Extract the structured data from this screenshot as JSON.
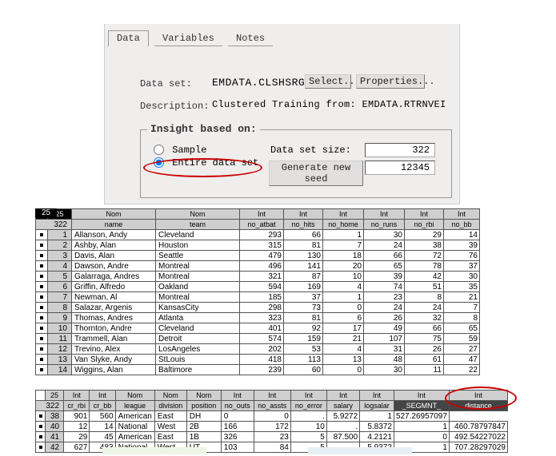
{
  "tabs": {
    "data": "Data",
    "vars": "Variables",
    "notes": "Notes"
  },
  "labels": {
    "dataset": "Data set:",
    "desc": "Description:",
    "insight": "Insight based on:",
    "sample": "Sample",
    "entire": "Entire data set",
    "dssize": "Data set size:",
    "genseed": "Generate new seed",
    "select": "Select...",
    "props": "Properties..."
  },
  "fields": {
    "dataset": "EMDATA.CLSHSRGQ",
    "desc": "Clustered Training from: EMDATA.RTRNVEI",
    "dssize": "322",
    "seed": "12345"
  },
  "grid1": {
    "top_left": "25",
    "total": "322",
    "types": [
      "Nom",
      "Nom",
      "Int",
      "Int",
      "Int",
      "Int",
      "Int",
      "Int"
    ],
    "headers": [
      "name",
      "team",
      "no_atbat",
      "no_hits",
      "no_home",
      "no_runs",
      "no_rbi",
      "no_bb"
    ],
    "rows": [
      [
        1,
        "Allanson, Andy",
        "Cleveland",
        293,
        66,
        1,
        30,
        29,
        14
      ],
      [
        2,
        "Ashby, Alan",
        "Houston",
        315,
        81,
        7,
        24,
        38,
        39
      ],
      [
        3,
        "Davis, Alan",
        "Seattle",
        479,
        130,
        18,
        66,
        72,
        76
      ],
      [
        4,
        "Dawson, Andre",
        "Montreal",
        496,
        141,
        20,
        65,
        78,
        37
      ],
      [
        5,
        "Galarraga, Andres",
        "Montreal",
        321,
        87,
        10,
        39,
        42,
        30
      ],
      [
        6,
        "Griffin, Alfredo",
        "Oakland",
        594,
        169,
        4,
        74,
        51,
        35
      ],
      [
        7,
        "Newman, Al",
        "Montreal",
        185,
        37,
        1,
        23,
        8,
        21
      ],
      [
        8,
        "Salazar, Argenis",
        "KansasCity",
        298,
        73,
        0,
        24,
        24,
        7
      ],
      [
        9,
        "Thomas, Andres",
        "Atlanta",
        323,
        81,
        6,
        26,
        32,
        8
      ],
      [
        10,
        "Thornton, Andre",
        "Cleveland",
        401,
        92,
        17,
        49,
        66,
        65
      ],
      [
        11,
        "Trammell, Alan",
        "Detroit",
        574,
        159,
        21,
        107,
        75,
        59
      ],
      [
        12,
        "Trevino, Alex",
        "LosAngeles",
        202,
        53,
        4,
        31,
        26,
        27
      ],
      [
        13,
        "Van Slyke, Andy",
        "StLouis",
        418,
        113,
        13,
        48,
        61,
        47
      ],
      [
        14,
        "Wiggins, Alan",
        "Baltimore",
        239,
        60,
        0,
        30,
        11,
        22
      ]
    ]
  },
  "grid2": {
    "top_left": "25",
    "total": "322",
    "types": [
      "Int",
      "Int",
      "Nom",
      "Nom",
      "Nom",
      "Int",
      "Int",
      "Int",
      "Int",
      "Int",
      "Int",
      "Int"
    ],
    "headers": [
      "cr_rbi",
      "cr_bb",
      "league",
      "division",
      "position",
      "no_outs",
      "no_assts",
      "no_error",
      "salary",
      "logsalar",
      "_SEGMNT_",
      "distance"
    ],
    "rows": [
      [
        38,
        901,
        560,
        "American",
        "East",
        "DH",
        0,
        0,
        ".",
        5.9272,
        1,
        "527.26957097"
      ],
      [
        40,
        12,
        14,
        "National",
        "West",
        "2B",
        166,
        172,
        10,
        ".",
        5.8372,
        1,
        "460.78797847"
      ],
      [
        41,
        29,
        45,
        "American",
        "East",
        "1B",
        326,
        23,
        5,
        "87.500",
        4.2121,
        0,
        "492.54227022"
      ],
      [
        42,
        627,
        483,
        "National",
        "West",
        "UT",
        103,
        84,
        5,
        ".",
        5.9372,
        1,
        "707.28297029"
      ]
    ]
  }
}
